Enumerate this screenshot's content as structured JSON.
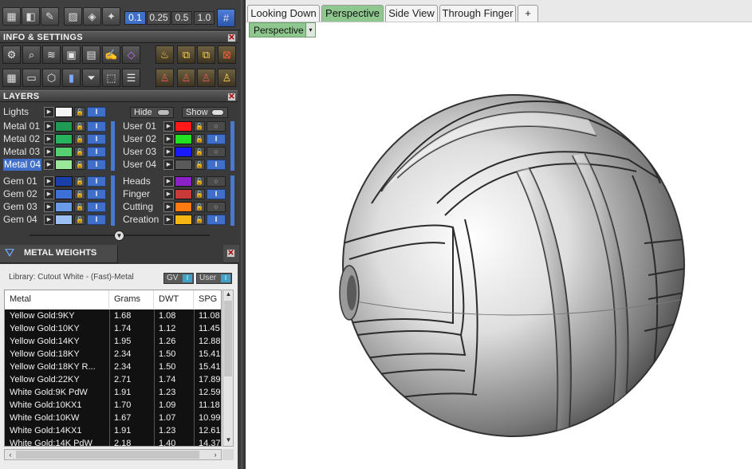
{
  "toolbar": {
    "icons": [
      "grid-icon",
      "cube-icon",
      "pen-icon",
      "hatch-icon",
      "eye-icon",
      "pin-icon"
    ],
    "snap_values": [
      "0.1",
      "0.25",
      "0.5",
      "1.0"
    ],
    "active_snap": "0.1"
  },
  "info_settings": {
    "title": "INFO & SETTINGS",
    "close": "✕",
    "row1_icons": [
      "gear-settings-icon",
      "magnifier-icon",
      "layers-stack-icon",
      "box-icon",
      "document-icon",
      "edit-icon",
      "cube-outline-icon"
    ],
    "row1_right_icons": [
      "lamp-icon",
      "render-icon",
      "render-alt-icon",
      "render-x-icon"
    ],
    "row2_icons": [
      "panels-icon",
      "monitor-icon",
      "wireframe-cube-icon",
      "book-icon",
      "filter-icon",
      "selection-icon",
      "notes-icon"
    ],
    "row2_right_icons": [
      "figure-icon",
      "figure-x-icon",
      "figure-alt-icon",
      "figure-gold-icon"
    ]
  },
  "layers": {
    "title": "LAYERS",
    "close": "✕",
    "lights_label": "Lights",
    "hide_label": "Hide",
    "show_label": "Show",
    "left_group1": [
      {
        "name": "Metal 01",
        "color": "#1f9a55"
      },
      {
        "name": "Metal 02",
        "color": "#27b35e"
      },
      {
        "name": "Metal 03",
        "color": "#55cf72"
      },
      {
        "name": "Metal 04",
        "color": "#9be89a",
        "selected": true
      }
    ],
    "left_group2": [
      {
        "name": "Gem 01",
        "color": "#1a3fa8"
      },
      {
        "name": "Gem 02",
        "color": "#3d6fd6"
      },
      {
        "name": "Gem 03",
        "color": "#6b9be8"
      },
      {
        "name": "Gem 04",
        "color": "#9cc0f2"
      }
    ],
    "right_group1": [
      {
        "name": "User 01",
        "color": "#ff1a1a"
      },
      {
        "name": "User 02",
        "color": "#22e022"
      },
      {
        "name": "User 03",
        "color": "#1a1aff"
      },
      {
        "name": "User 04",
        "color": "#5a5a5a"
      }
    ],
    "right_group2": [
      {
        "name": "Heads",
        "color": "#8a22c8"
      },
      {
        "name": "Finger",
        "color": "#c83a3a"
      },
      {
        "name": "Cutting",
        "color": "#ff7a10"
      },
      {
        "name": "Creation",
        "color": "#f5b514"
      }
    ]
  },
  "metal_weights": {
    "title": "METAL WEIGHTS",
    "close": "✕",
    "library": "Library: Cutout White - (Fast)-Metal",
    "gv_label": "GV",
    "user_label": "User",
    "columns": [
      "Metal",
      "Grams",
      "DWT",
      "SPG"
    ],
    "rows": [
      [
        "Yellow Gold:9KY",
        "1.68",
        "1.08",
        "11.08"
      ],
      [
        "Yellow Gold:10KY",
        "1.74",
        "1.12",
        "11.45"
      ],
      [
        "Yellow Gold:14KY",
        "1.95",
        "1.26",
        "12.88"
      ],
      [
        "Yellow Gold:18KY",
        "2.34",
        "1.50",
        "15.41"
      ],
      [
        "Yellow Gold:18KY R...",
        "2.34",
        "1.50",
        "15.41"
      ],
      [
        "Yellow Gold:22KY",
        "2.71",
        "1.74",
        "17.89"
      ],
      [
        "White Gold:9K PdW",
        "1.91",
        "1.23",
        "12.59"
      ],
      [
        "White Gold:10KX1",
        "1.70",
        "1.09",
        "11.18"
      ],
      [
        "White Gold:10KW",
        "1.67",
        "1.07",
        "10.99"
      ],
      [
        "White Gold:14KX1",
        "1.91",
        "1.23",
        "12.61"
      ],
      [
        "White Gold:14K PdW",
        "2.18",
        "1.40",
        "14.37"
      ]
    ]
  },
  "viewport": {
    "tabs": [
      "Looking Down",
      "Perspective",
      "Side View",
      "Through Finger"
    ],
    "active_tab": "Perspective",
    "add_tab": "+",
    "view_name": "Perspective",
    "dropdown_glyph": "▾"
  },
  "colors": {
    "accent_blue": "#3f6fc8",
    "tab_active_green": "#8fc88f",
    "panel_dark": "#3a3a3a"
  }
}
